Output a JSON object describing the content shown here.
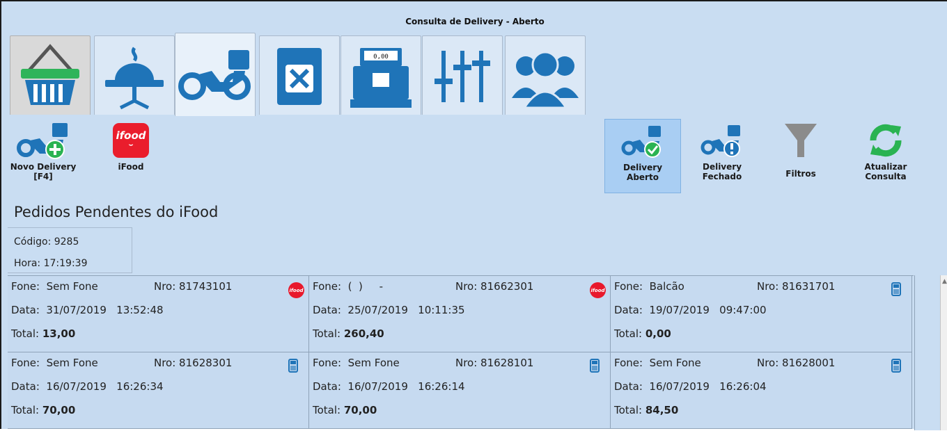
{
  "window": {
    "title": "Consulta de Delivery - Aberto"
  },
  "module_tabs": [
    {
      "icon": "shopping-basket-icon"
    },
    {
      "icon": "restaurant-table-icon"
    },
    {
      "icon": "delivery-motorcycle-icon",
      "active": true
    },
    {
      "icon": "menu-book-icon"
    },
    {
      "icon": "cash-register-icon",
      "display": "0,00"
    },
    {
      "icon": "sliders-settings-icon"
    },
    {
      "icon": "users-group-icon"
    }
  ],
  "toolbar": {
    "new_delivery_label": "Novo Delivery",
    "new_delivery_shortcut": "[F4]",
    "ifood_label": "iFood",
    "ifood_logo_text": "ifood",
    "delivery_open_line1": "Delivery",
    "delivery_open_line2": "Aberto",
    "delivery_closed_line1": "Delivery",
    "delivery_closed_line2": "Fechado",
    "filters_label": "Filtros",
    "refresh_line1": "Atualizar",
    "refresh_line2": "Consulta"
  },
  "pending": {
    "title": "Pedidos Pendentes do iFood",
    "code_line": "Código: 9285",
    "time_line": "Hora: 17:19:39"
  },
  "orders": [
    {
      "fone": "Fone:  Sem Fone",
      "nro": "Nro: 81743101",
      "data": "Data:  31/07/2019   13:52:48",
      "total_label": "Total: ",
      "total": "13,00",
      "source": "ifood"
    },
    {
      "fone": "Fone:  (  )     -",
      "nro": "Nro: 81662301",
      "data": "Data:  25/07/2019   10:11:35",
      "total_label": "Total: ",
      "total": "260,40",
      "source": "ifood"
    },
    {
      "fone": "Fone:  Balcão",
      "nro": "Nro: 81631701",
      "data": "Data:  19/07/2019   09:47:00",
      "total_label": "Total: ",
      "total": "0,00",
      "source": "pos"
    },
    {
      "fone": "Fone:  Sem Fone",
      "nro": "Nro: 81628301",
      "data": "Data:  16/07/2019   16:26:34",
      "total_label": "Total: ",
      "total": "70,00",
      "source": "pos"
    },
    {
      "fone": "Fone:  Sem Fone",
      "nro": "Nro: 81628101",
      "data": "Data:  16/07/2019   16:26:14",
      "total_label": "Total: ",
      "total": "70,00",
      "source": "pos"
    },
    {
      "fone": "Fone:  Sem Fone",
      "nro": "Nro: 81628001",
      "data": "Data:  16/07/2019   16:26:04",
      "total_label": "Total: ",
      "total": "84,50",
      "source": "pos"
    }
  ],
  "colors": {
    "background": "#c9ddf2",
    "accent_blue": "#1f74b8",
    "ifood_red": "#ea1d2c",
    "success_green": "#2ab352",
    "selected_tool": "#a9cef3"
  }
}
